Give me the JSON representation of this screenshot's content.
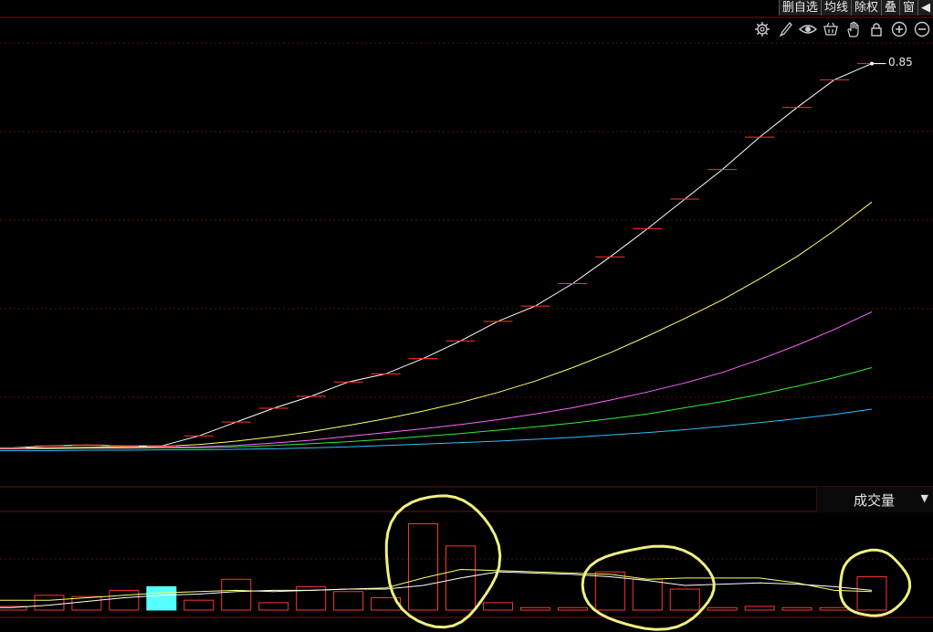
{
  "toolbar": {
    "buttons": [
      "删自选",
      "均线",
      "除权",
      "叠",
      "窗"
    ]
  },
  "tools": {
    "icons": [
      "gear-icon",
      "brush-icon",
      "eye-icon",
      "basket-icon",
      "hand-icon",
      "lock-icon",
      "zoom-in-icon",
      "zoom-out-icon"
    ]
  },
  "volume_indicator": {
    "selected": "成交量"
  },
  "last_value_label": "0.85",
  "colors": {
    "background": "#000000",
    "grid": "#5a0f0f",
    "price_line": "#ffffff",
    "ma1": "#ffff66",
    "ma2": "#ff66ff",
    "ma3": "#33ee33",
    "ma4": "#33bbff",
    "up_bar": "#ff3333",
    "highlight_bar": "#55ffff",
    "annotation": "#f0f080"
  },
  "chart_data": [
    {
      "type": "line",
      "panel": "price",
      "x": [
        1,
        2,
        3,
        4,
        5,
        6,
        7,
        8,
        9,
        10,
        11,
        12,
        13,
        14,
        15,
        16,
        17,
        18,
        19,
        20,
        21,
        22,
        23,
        24
      ],
      "series": [
        {
          "values": [
            0.048,
            0.052,
            0.054,
            0.052,
            0.052,
            0.073,
            0.102,
            0.131,
            0.156,
            0.186,
            0.203,
            0.235,
            0.272,
            0.313,
            0.345,
            0.392,
            0.448,
            0.507,
            0.569,
            0.631,
            0.699,
            0.761,
            0.819,
            0.853
          ]
        },
        {
          "values": [
            0.047,
            0.048,
            0.049,
            0.05,
            0.051,
            0.055,
            0.062,
            0.071,
            0.082,
            0.095,
            0.109,
            0.125,
            0.143,
            0.164,
            0.188,
            0.216,
            0.247,
            0.282,
            0.319,
            0.358,
            0.402,
            0.449,
            0.503,
            0.563
          ]
        },
        {
          "values": [
            0.046,
            0.047,
            0.048,
            0.048,
            0.049,
            0.05,
            0.053,
            0.058,
            0.064,
            0.072,
            0.08,
            0.088,
            0.097,
            0.107,
            0.119,
            0.132,
            0.148,
            0.165,
            0.184,
            0.206,
            0.233,
            0.263,
            0.296,
            0.333
          ]
        },
        {
          "values": [
            0.046,
            0.046,
            0.047,
            0.047,
            0.048,
            0.048,
            0.05,
            0.053,
            0.057,
            0.061,
            0.066,
            0.072,
            0.078,
            0.085,
            0.092,
            0.1,
            0.109,
            0.119,
            0.132,
            0.145,
            0.16,
            0.177,
            0.195,
            0.216
          ]
        },
        {
          "values": [
            0.042,
            0.042,
            0.043,
            0.043,
            0.044,
            0.044,
            0.045,
            0.046,
            0.048,
            0.05,
            0.053,
            0.056,
            0.059,
            0.062,
            0.066,
            0.07,
            0.075,
            0.08,
            0.086,
            0.093,
            0.101,
            0.109,
            0.118,
            0.129
          ]
        }
      ],
      "ylim": [
        0.02,
        0.9
      ],
      "point_labels": [
        "0.85"
      ]
    },
    {
      "type": "bar",
      "panel": "volume",
      "title": "成交量",
      "x": [
        1,
        2,
        3,
        4,
        5,
        6,
        7,
        8,
        9,
        10,
        11,
        12,
        13,
        14,
        15,
        16,
        17,
        18,
        19,
        20,
        21,
        22,
        23,
        24
      ],
      "series": [
        {
          "values": [
            3,
            12,
            11,
            16,
            19,
            8,
            25,
            6,
            19,
            15,
            10,
            70,
            52,
            6,
            2,
            2,
            31,
            25,
            17,
            2,
            3,
            2,
            2,
            27
          ]
        },
        {
          "values": [
            8,
            8,
            10,
            12,
            14,
            15,
            16,
            15,
            16,
            17,
            18,
            26,
            33,
            32,
            31,
            30,
            29,
            25,
            26,
            26,
            26,
            22,
            16,
            15
          ]
        },
        {
          "values": [
            2,
            4,
            7,
            10,
            12,
            13,
            15,
            16,
            16,
            17,
            17,
            20,
            26,
            31,
            30,
            29,
            27,
            24,
            20,
            21,
            22,
            21,
            19,
            16
          ]
        }
      ],
      "highlight_bar": 5,
      "ylim": [
        0,
        80
      ]
    }
  ]
}
